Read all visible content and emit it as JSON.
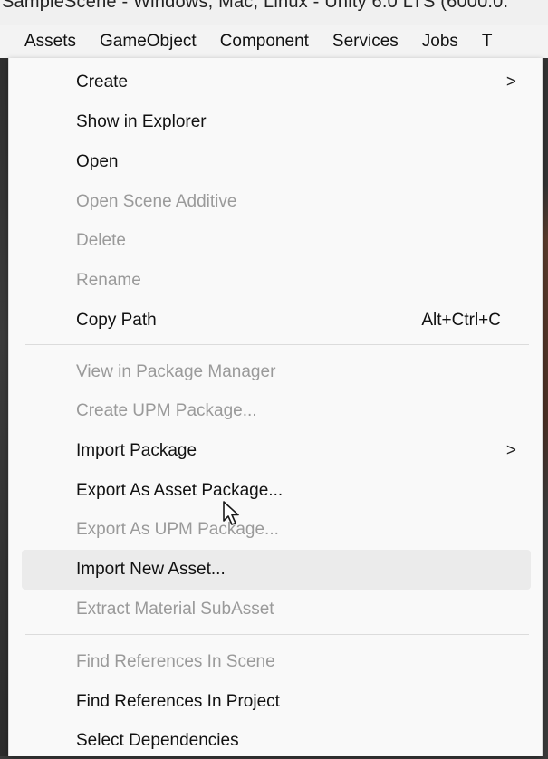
{
  "window": {
    "title": "SampleScene - Windows, Mac, Linux - Unity 6.0 LTS (6000.0."
  },
  "menubar": {
    "items": [
      "Assets",
      "GameObject",
      "Component",
      "Services",
      "Jobs",
      "T"
    ]
  },
  "menu": {
    "items": [
      {
        "label": "Create",
        "enabled": true,
        "submenu": true
      },
      {
        "label": "Show in Explorer",
        "enabled": true
      },
      {
        "label": "Open",
        "enabled": true
      },
      {
        "label": "Open Scene Additive",
        "enabled": false
      },
      {
        "label": "Delete",
        "enabled": false
      },
      {
        "label": "Rename",
        "enabled": false
      },
      {
        "label": "Copy Path",
        "enabled": true,
        "shortcut": "Alt+Ctrl+C"
      },
      {
        "label": "View in Package Manager",
        "enabled": false
      },
      {
        "label": "Create UPM Package...",
        "enabled": false
      },
      {
        "label": "Import Package",
        "enabled": true,
        "submenu": true
      },
      {
        "label": "Export As Asset Package...",
        "enabled": true
      },
      {
        "label": "Export As UPM Package...",
        "enabled": false
      },
      {
        "label": "Import New Asset...",
        "enabled": true,
        "hovered": true
      },
      {
        "label": "Extract Material SubAsset",
        "enabled": false
      },
      {
        "label": "Find References In Scene",
        "enabled": false
      },
      {
        "label": "Find References In Project",
        "enabled": true
      },
      {
        "label": "Select Dependencies",
        "enabled": true
      }
    ],
    "submenu_arrow": ">"
  },
  "colors": {
    "menu_bg": "#f9f9f9",
    "enabled_text": "#111111",
    "disabled_text": "#9a9a9a",
    "hover_bg": "#ebebeb",
    "separator": "#dcdcdc"
  },
  "icons": {
    "cursor": "arrow-cursor-icon",
    "submenu": "chevron-right-icon"
  }
}
